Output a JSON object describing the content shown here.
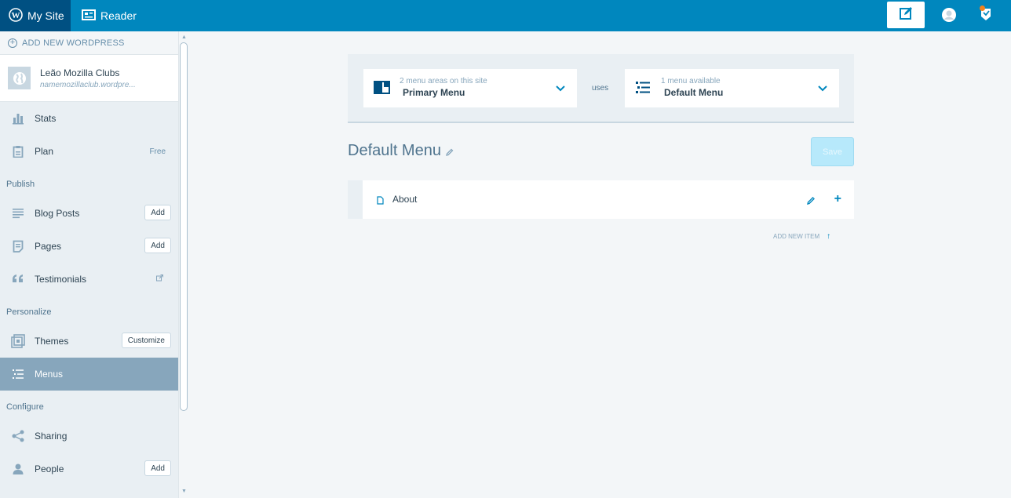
{
  "masterbar": {
    "my_site": "My Site",
    "reader": "Reader"
  },
  "sidebar": {
    "add_new": "Add New WordPress",
    "site": {
      "name": "Leão Mozilla Clubs",
      "url": "namemozillaclub.wordpre..."
    },
    "items": {
      "stats": "Stats",
      "plan": "Plan",
      "plan_badge": "Free",
      "publish_heading": "Publish",
      "blog_posts": "Blog Posts",
      "blog_posts_btn": "Add",
      "pages": "Pages",
      "pages_btn": "Add",
      "testimonials": "Testimonials",
      "personalize_heading": "Personalize",
      "themes": "Themes",
      "themes_btn": "Customize",
      "menus": "Menus",
      "configure_heading": "Configure",
      "sharing": "Sharing",
      "people": "People",
      "people_btn": "Add"
    }
  },
  "menus": {
    "location": {
      "caption": "2 menu areas on this site",
      "value": "Primary Menu"
    },
    "uses": "uses",
    "menu": {
      "caption": "1 menu available",
      "value": "Default Menu"
    },
    "title": "Default Menu",
    "save": "Save",
    "item_name": "About",
    "add_new_item": "Add new item"
  },
  "colors": {
    "masterbar": "#0087be",
    "masterbar_active": "#005082",
    "sidebar_selected": "#87a6bc",
    "accent": "#0087be"
  }
}
